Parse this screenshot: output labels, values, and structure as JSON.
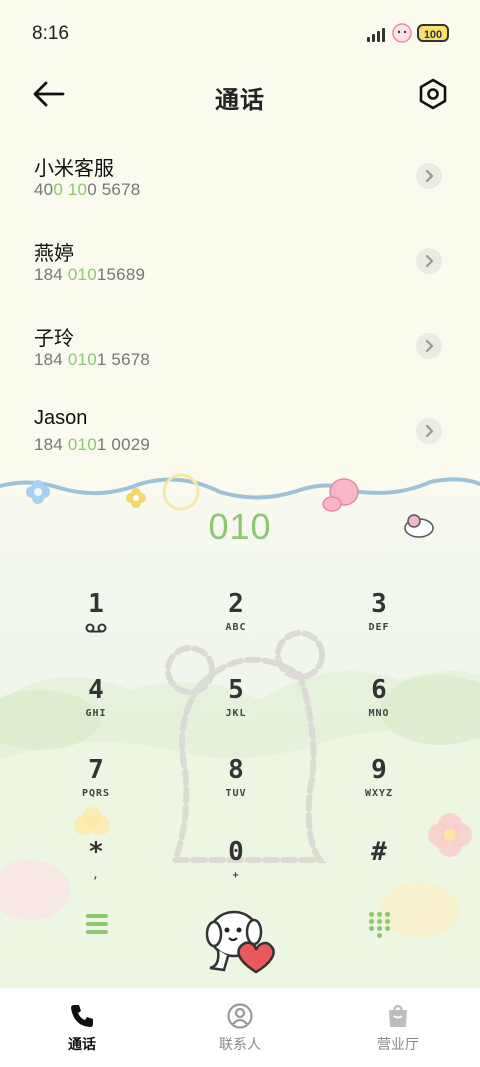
{
  "status_bar": {
    "time": "8:16",
    "battery": "100"
  },
  "header": {
    "title": "通话"
  },
  "contacts": [
    {
      "name": "小米客服",
      "num_a": "40",
      "num_hl": "0 10",
      "num_b": "0 5678"
    },
    {
      "name": "燕婷",
      "num_a": "184 ",
      "num_hl": "010",
      "num_b": "15689"
    },
    {
      "name": "子玲",
      "num_a": "184 ",
      "num_hl": "010",
      "num_b": "1 5678"
    },
    {
      "name": "Jason",
      "num_a": "184 ",
      "num_hl": "010",
      "num_b": "1 0029"
    }
  ],
  "dial": {
    "number": "010"
  },
  "keypad": [
    {
      "digit": "1",
      "letters": ""
    },
    {
      "digit": "2",
      "letters": "ABC"
    },
    {
      "digit": "3",
      "letters": "DEF"
    },
    {
      "digit": "4",
      "letters": "GHI"
    },
    {
      "digit": "5",
      "letters": "JKL"
    },
    {
      "digit": "6",
      "letters": "MNO"
    },
    {
      "digit": "7",
      "letters": "PQRS"
    },
    {
      "digit": "8",
      "letters": "TUV"
    },
    {
      "digit": "9",
      "letters": "WXYZ"
    },
    {
      "digit": "*",
      "letters": ","
    },
    {
      "digit": "0",
      "letters": "+"
    },
    {
      "digit": "#",
      "letters": ""
    }
  ],
  "bottom_nav": [
    {
      "label": "通话",
      "icon": "phone-icon",
      "active": true
    },
    {
      "label": "联系人",
      "icon": "contacts-icon",
      "active": false
    },
    {
      "label": "营业厅",
      "icon": "bag-icon",
      "active": false
    }
  ],
  "colors": {
    "accent": "#8ec771",
    "background": "#fbfaee",
    "heart": "#e9595c"
  }
}
